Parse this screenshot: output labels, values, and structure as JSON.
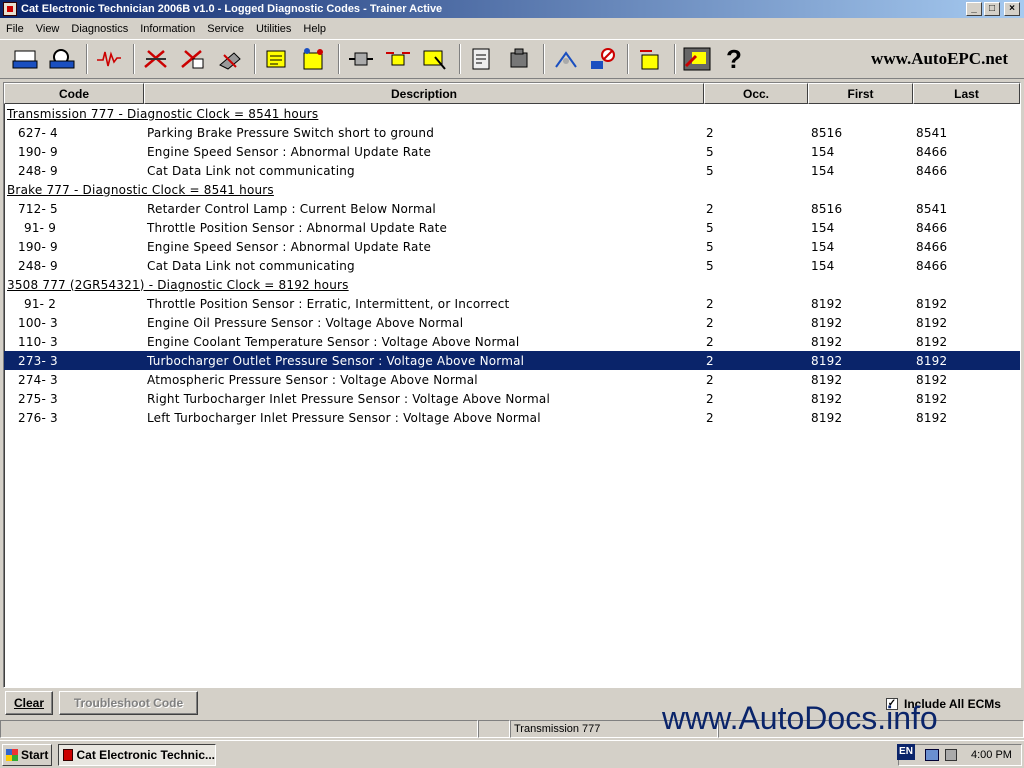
{
  "window": {
    "title": "Cat Electronic Technician 2006B v1.0 - Logged Diagnostic Codes - Trainer Active"
  },
  "menu": [
    "File",
    "View",
    "Diagnostics",
    "Information",
    "Service",
    "Utilities",
    "Help"
  ],
  "toolbar": {
    "brand": "www.AutoEPC.net",
    "help_glyph": "?"
  },
  "table": {
    "headers": [
      "Code",
      "Description",
      "Occ.",
      "First",
      "Last"
    ],
    "groups": [
      {
        "title": "Transmission 777 - Diagnostic Clock = 8541 hours",
        "rows": [
          {
            "code": "627- 4",
            "desc": "Parking Brake Pressure Switch short to ground",
            "occ": "2",
            "first": "8516",
            "last": "8541"
          },
          {
            "code": "190- 9",
            "desc": "Engine Speed Sensor : Abnormal Update Rate",
            "occ": "5",
            "first": "154",
            "last": "8466"
          },
          {
            "code": "248- 9",
            "desc": "Cat Data Link not communicating",
            "occ": "5",
            "first": "154",
            "last": "8466"
          }
        ]
      },
      {
        "title": "Brake 777 - Diagnostic Clock = 8541 hours",
        "rows": [
          {
            "code": "712- 5",
            "desc": "Retarder Control Lamp : Current Below Normal",
            "occ": "2",
            "first": "8516",
            "last": "8541"
          },
          {
            "code": "91- 9",
            "desc": "Throttle Position Sensor : Abnormal Update Rate",
            "occ": "5",
            "first": "154",
            "last": "8466"
          },
          {
            "code": "190- 9",
            "desc": "Engine Speed Sensor : Abnormal Update Rate",
            "occ": "5",
            "first": "154",
            "last": "8466"
          },
          {
            "code": "248- 9",
            "desc": "Cat Data Link not communicating",
            "occ": "5",
            "first": "154",
            "last": "8466"
          }
        ]
      },
      {
        "title": "3508 777 (2GR54321) - Diagnostic Clock = 8192 hours",
        "rows": [
          {
            "code": "91- 2",
            "desc": "Throttle Position Sensor : Erratic, Intermittent, or Incorrect",
            "occ": "2",
            "first": "8192",
            "last": "8192"
          },
          {
            "code": "100- 3",
            "desc": "Engine Oil Pressure Sensor : Voltage Above Normal",
            "occ": "2",
            "first": "8192",
            "last": "8192"
          },
          {
            "code": "110- 3",
            "desc": "Engine Coolant Temperature Sensor : Voltage Above Normal",
            "occ": "2",
            "first": "8192",
            "last": "8192"
          },
          {
            "code": "273- 3",
            "desc": "Turbocharger Outlet Pressure Sensor : Voltage Above Normal",
            "occ": "2",
            "first": "8192",
            "last": "8192",
            "selected": true
          },
          {
            "code": "274- 3",
            "desc": "Atmospheric Pressure Sensor : Voltage Above Normal",
            "occ": "2",
            "first": "8192",
            "last": "8192"
          },
          {
            "code": "275- 3",
            "desc": "Right Turbocharger Inlet Pressure Sensor : Voltage Above Normal",
            "occ": "2",
            "first": "8192",
            "last": "8192"
          },
          {
            "code": "276- 3",
            "desc": "Left Turbocharger Inlet Pressure Sensor : Voltage Above Normal",
            "occ": "2",
            "first": "8192",
            "last": "8192"
          }
        ]
      }
    ]
  },
  "buttons": {
    "clear": "Clear",
    "troubleshoot": "Troubleshoot Code"
  },
  "include_all_ecms": {
    "label": "Include All ECMs",
    "checked": true
  },
  "statusbar": {
    "ecm": "Transmission 777"
  },
  "watermark": "www.AutoDocs.info",
  "taskbar": {
    "start": "Start",
    "task": "Cat Electronic Technic...",
    "lang": "EN",
    "clock": "4:00 PM"
  },
  "colors": {
    "selection": "#0a246a",
    "titlebar": "#0a246a"
  }
}
